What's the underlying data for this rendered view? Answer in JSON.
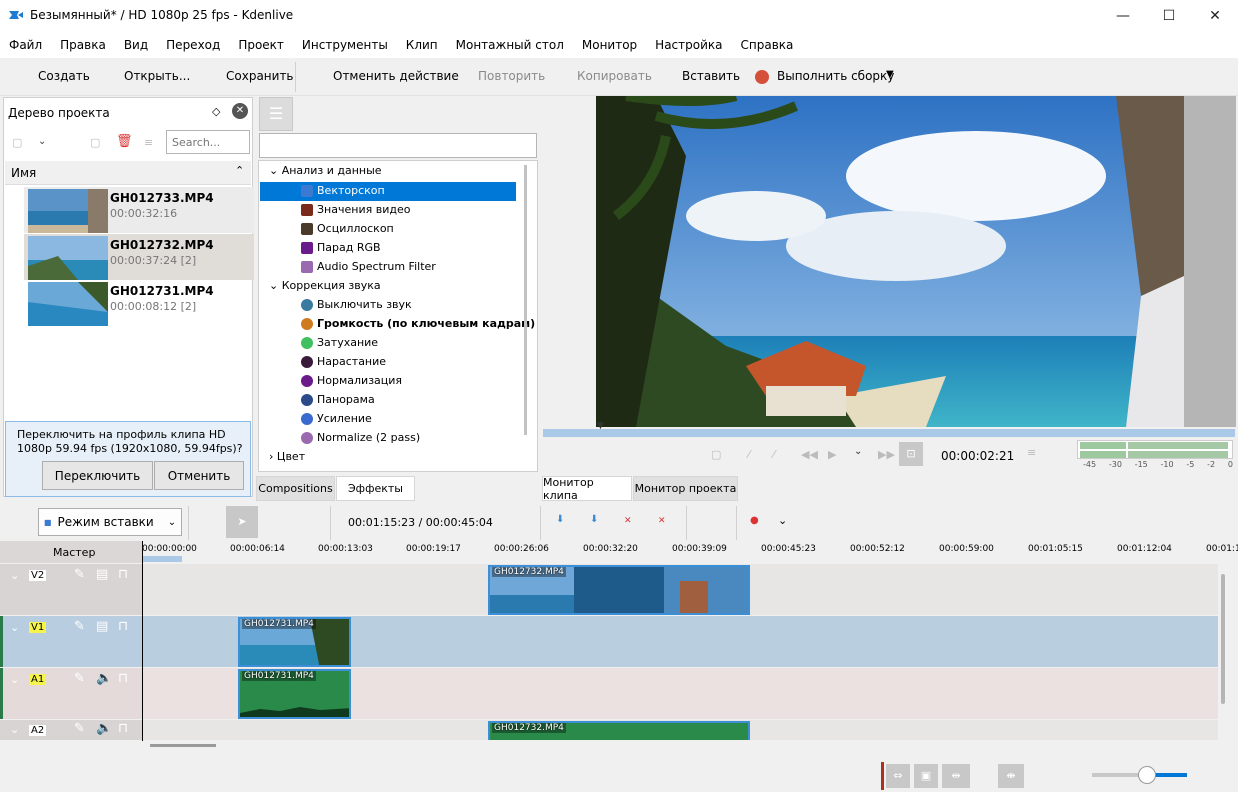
{
  "window": {
    "title": "Безымянный* / HD 1080p 25 fps - Kdenlive",
    "min": "—",
    "max": "☐",
    "close": "✕"
  },
  "menu": [
    "Файл",
    "Правка",
    "Вид",
    "Переход",
    "Проект",
    "Инструменты",
    "Клип",
    "Монтажный стол",
    "Монитор",
    "Настройка",
    "Справка"
  ],
  "toolbar": {
    "create": "Создать",
    "open": "Открыть...",
    "save": "Сохранить",
    "undo": "Отменить действие",
    "redo": "Повторить",
    "copy": "Копировать",
    "paste": "Вставить",
    "render": "Выполнить сборку"
  },
  "project": {
    "title": "Дерево проекта",
    "search_placeholder": "Search...",
    "col_name": "Имя",
    "clips": [
      {
        "name": "GH012733.MP4",
        "dur": "00:00:32:16"
      },
      {
        "name": "GH012732.MP4",
        "dur": "00:00:37:24 [2]"
      },
      {
        "name": "GH012731.MP4",
        "dur": "00:00:08:12 [2]"
      }
    ],
    "profile_msg": "Переключить на профиль клипа HD 1080p 59.94 fps (1920x1080, 59.94fps)?",
    "switch": "Переключить",
    "cancel": "Отменить"
  },
  "effects": {
    "categories": [
      {
        "name": "Анализ и данные",
        "items": [
          {
            "label": "Векторскоп",
            "color": "#3a7ad0",
            "sel": true
          },
          {
            "label": "Значения видео",
            "color": "#7a2a1a"
          },
          {
            "label": "Осциллоскоп",
            "color": "#4a3a2a"
          },
          {
            "label": "Парад RGB",
            "color": "#6a1a8a"
          },
          {
            "label": "Audio Spectrum Filter",
            "color": "#9a6ab0"
          }
        ]
      },
      {
        "name": "Коррекция звука",
        "items": [
          {
            "label": "Выключить звук",
            "color": "#3a7aa0"
          },
          {
            "label": "Громкость (по ключевым кадрам)",
            "color": "#d07a20",
            "bold": true
          },
          {
            "label": "Затухание",
            "color": "#40c060"
          },
          {
            "label": "Нарастание",
            "color": "#3a1a3a"
          },
          {
            "label": "Нормализация",
            "color": "#6a1a8a"
          },
          {
            "label": "Панорама",
            "color": "#2a4a8a"
          },
          {
            "label": "Усиление",
            "color": "#3a6ad0"
          },
          {
            "label": "Normalize (2 pass)",
            "color": "#9a6ab0"
          }
        ]
      },
      {
        "name": "Цвет",
        "items": []
      }
    ],
    "tab_compositions": "Compositions",
    "tab_effects": "Эффекты"
  },
  "monitor": {
    "timecode": "00:00:02:21",
    "tab_clip": "Монитор клипа",
    "tab_project": "Монитор проекта",
    "meter_labels": [
      "-45",
      "-30",
      "-15",
      "-10",
      "-5",
      "-2",
      "0"
    ]
  },
  "timeline": {
    "mode": "Режим вставки",
    "position": "00:01:15:23 / 00:00:45:04",
    "master": "Мастер",
    "ruler": [
      "00:00:00:00",
      "00:00:06:14",
      "00:00:13:03",
      "00:00:19:17",
      "00:00:26:06",
      "00:00:32:20",
      "00:00:39:09",
      "00:00:45:23",
      "00:00:52:12",
      "00:00:59:00",
      "00:01:05:15",
      "00:01:12:04",
      "00:01:1"
    ],
    "tracks": [
      {
        "name": "V2",
        "hl": false
      },
      {
        "name": "V1",
        "hl": true
      },
      {
        "name": "A1",
        "hl": true
      },
      {
        "name": "A2",
        "hl": false
      }
    ],
    "clips": {
      "v2": "GH012732.MP4",
      "v1": "GH012731.MP4",
      "a1": "GH012731.MP4",
      "a2": "GH012732.MP4"
    }
  },
  "colors": {
    "accent": "#0078d7",
    "selection": "#0078d7",
    "audio_clip": "#2a8a4a"
  }
}
